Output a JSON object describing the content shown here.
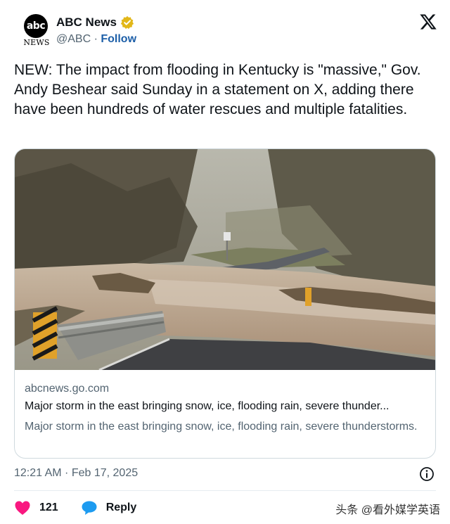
{
  "author": {
    "display_name": "ABC News",
    "handle": "@ABC",
    "separator": " · ",
    "follow_label": "Follow",
    "avatar_text": "abc",
    "avatar_caption": "NEWS",
    "verified_color": "#E2B719"
  },
  "platform_icon": "x-logo-icon",
  "tweet": {
    "text": "NEW: The impact from flooding in Kentucky is \"massive,\" Gov. Andy Beshear said Sunday in a statement on X, adding there have been hundreds of water rescues and multiple fatalities."
  },
  "link_card": {
    "domain": "abcnews.go.com",
    "title": "Major storm in the east bringing snow, ice, flooding rain, severe thunder...",
    "description": "Major storm in the east bringing snow, ice, flooding rain, severe thunderstorms."
  },
  "meta": {
    "timestamp": "12:21 AM · Feb 17, 2025"
  },
  "actions": {
    "like_count": "121",
    "reply_label": "Reply",
    "like_color": "#F91880",
    "reply_color": "#1D9BF0"
  },
  "watermark": "头条 @看外媒学英语"
}
